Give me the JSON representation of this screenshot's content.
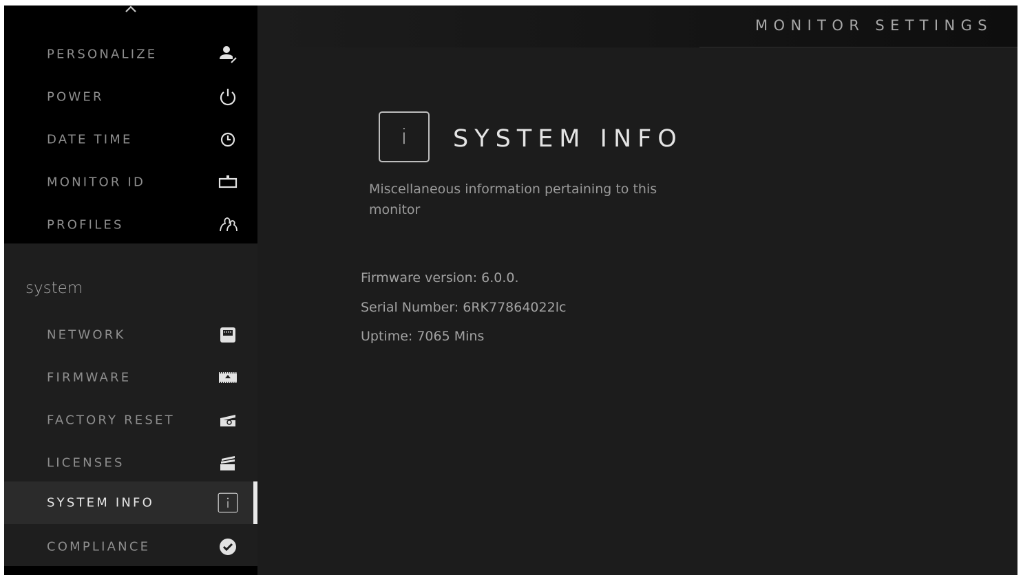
{
  "header": {
    "title": "MONITOR SETTINGS"
  },
  "sidebar": {
    "scroll_up_icon": "chevron-up-icon",
    "top_items": [
      {
        "label": "PERSONALIZE",
        "icon": "person-edit-icon"
      },
      {
        "label": "POWER",
        "icon": "power-icon"
      },
      {
        "label": "DATE TIME",
        "icon": "clock-icon"
      },
      {
        "label": "MONITOR ID",
        "icon": "id-tag-icon"
      },
      {
        "label": "PROFILES",
        "icon": "profiles-icon"
      }
    ],
    "section_heading": "system",
    "system_items": [
      {
        "label": "NETWORK",
        "icon": "ethernet-port-icon"
      },
      {
        "label": "FIRMWARE",
        "icon": "chip-upload-icon"
      },
      {
        "label": "FACTORY RESET",
        "icon": "reset-clapper-icon"
      },
      {
        "label": "LICENSES",
        "icon": "license-cards-icon"
      },
      {
        "label": "SYSTEM INFO",
        "icon": "info-icon",
        "active": true
      },
      {
        "label": "COMPLIANCE",
        "icon": "checkmark-circle-icon"
      }
    ]
  },
  "main": {
    "icon_glyph": "i",
    "title": "SYSTEM INFO",
    "description": "Miscellaneous information pertaining to this monitor",
    "info_lines": [
      "Firmware version: 6.0.0.",
      "Serial Number: 6RK77864022lc",
      "Uptime: 7065 Mins"
    ]
  },
  "colors": {
    "background": "#1c1c1c",
    "sidebar_top": "#000000",
    "active_item": "#2b2b2b",
    "active_indicator": "#e9e9e9",
    "nav_text": "#8e8e8e",
    "title_text": "#e4e4e4"
  }
}
